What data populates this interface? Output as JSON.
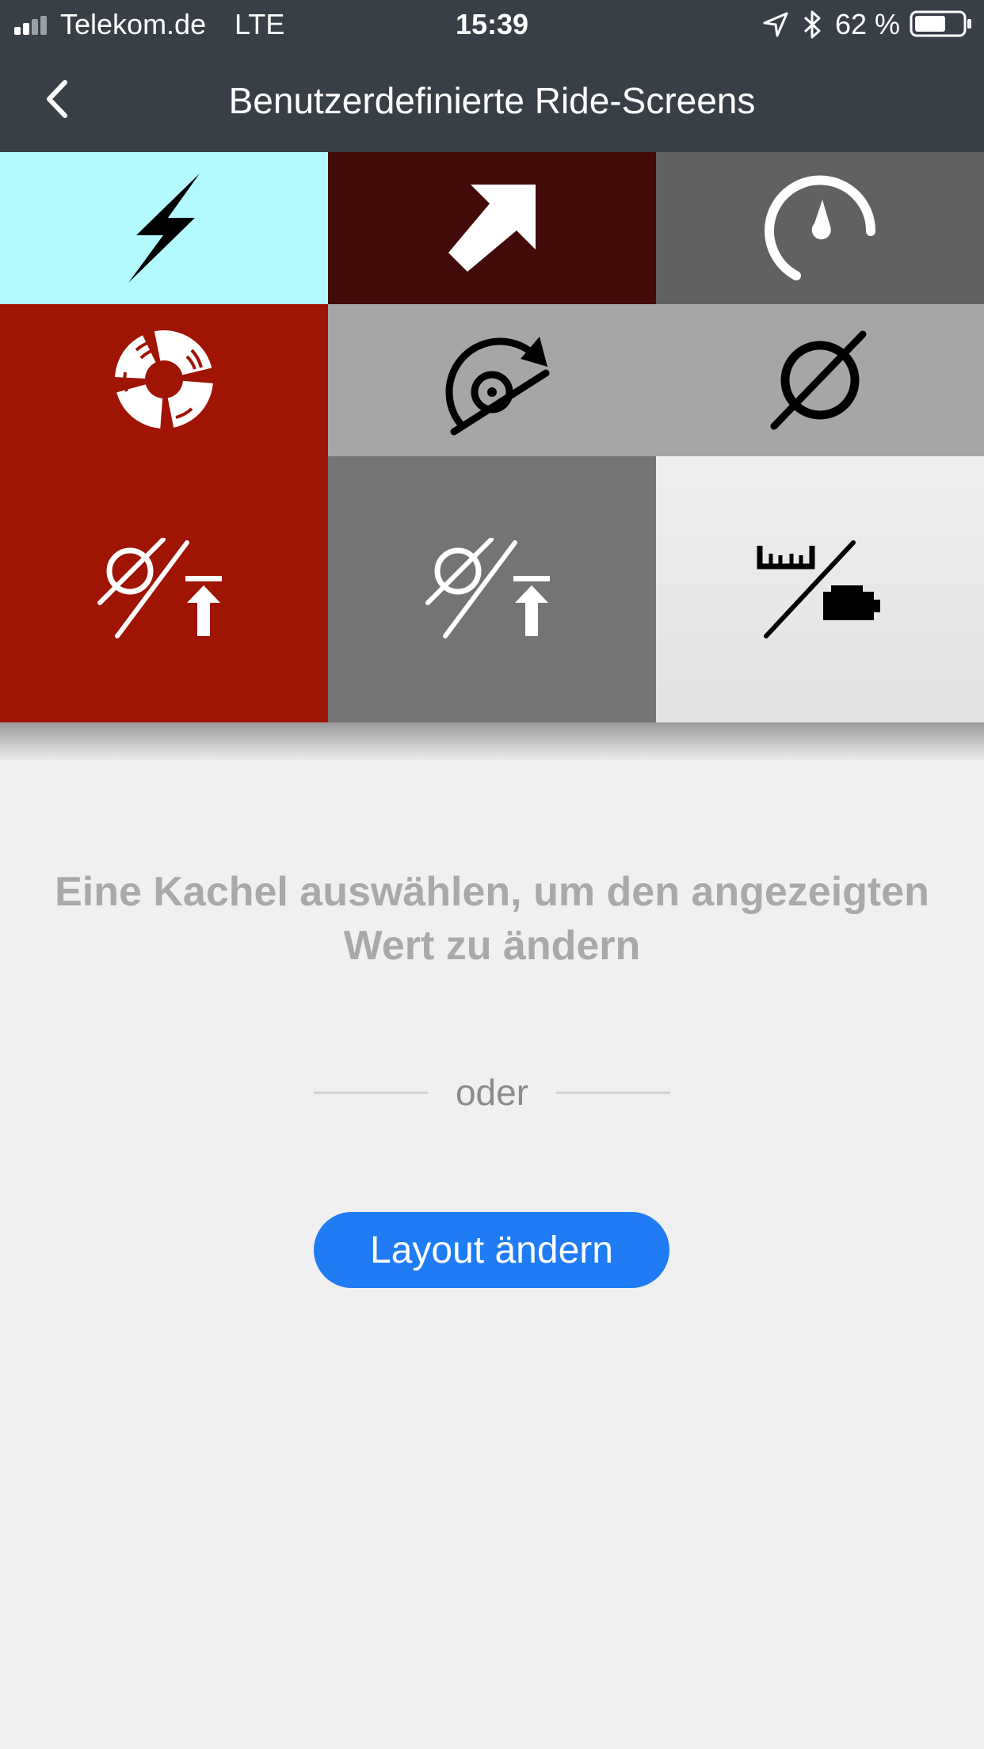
{
  "status_bar": {
    "carrier": "Telekom.de",
    "network": "LTE",
    "time": "15:39",
    "battery": "62 %",
    "icons": [
      "signal-icon",
      "location-arrow-icon",
      "bluetooth-icon",
      "battery-icon"
    ]
  },
  "nav": {
    "title": "Benutzerdefinierte Ride-Screens",
    "back_icon": "chevron-left-icon"
  },
  "tiles": [
    {
      "icon": "lightning-icon",
      "color": "#b2fafe"
    },
    {
      "icon": "arrow-up-right-icon",
      "color": "#420a09"
    },
    {
      "icon": "speedometer-icon",
      "color": "#616161"
    },
    {
      "icon": "lifebuoy-icon",
      "color": "#a01404"
    },
    {
      "icon": "average-speed-arrow-icon",
      "color": "#a6a6a6"
    },
    {
      "icon": "average-icon",
      "color": "#a6a6a6"
    },
    {
      "icon": "average-max-icon",
      "color": "#a01404"
    },
    {
      "icon": "average-max-icon",
      "color": "#747474"
    },
    {
      "icon": "distance-range-battery-icon",
      "color": "#e6e6e6"
    }
  ],
  "main": {
    "hint": "Eine Kachel auswählen, um den angezeigten Wert zu ändern",
    "divider": "oder",
    "layout_button": "Layout ändern"
  },
  "colors": {
    "header": "#393f47",
    "background": "#f0f0f1",
    "accent": "#1f7cf5"
  }
}
